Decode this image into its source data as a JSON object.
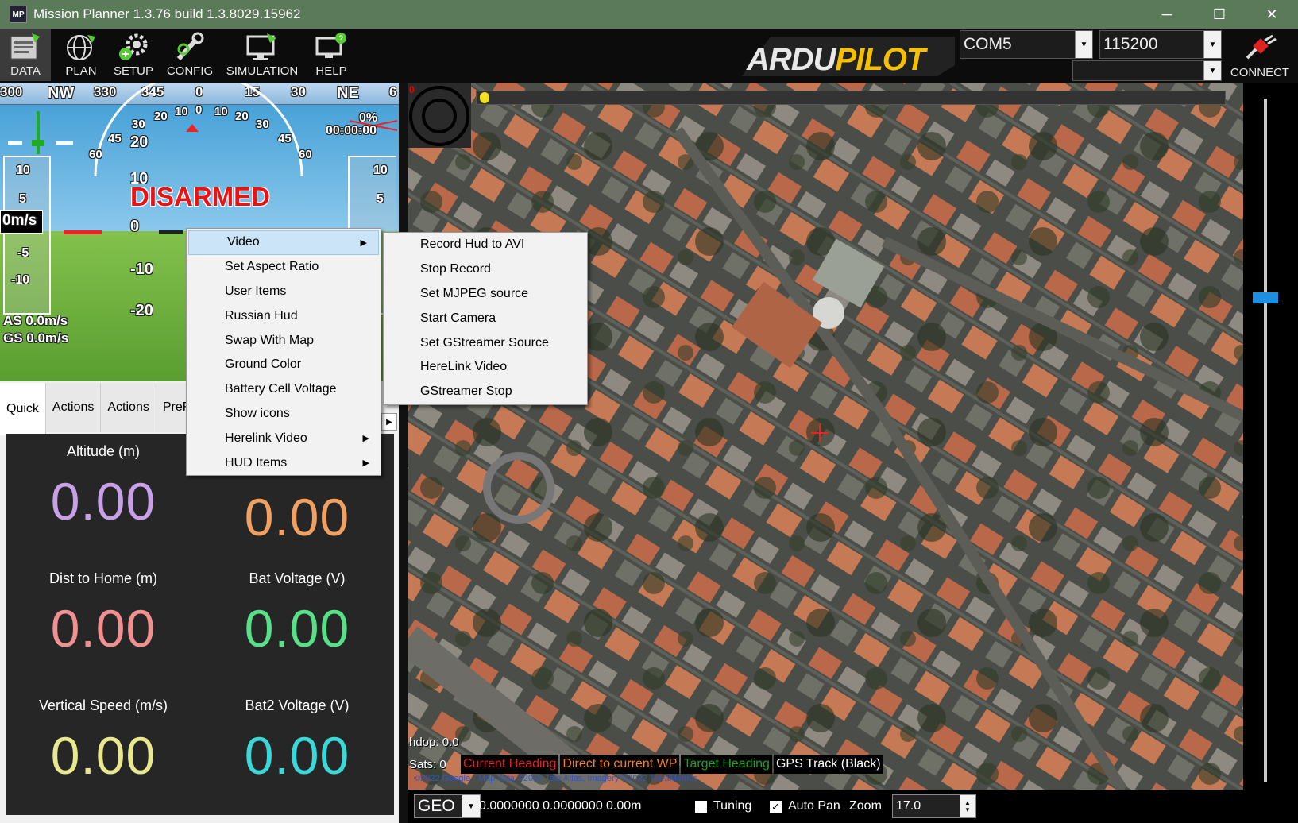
{
  "window": {
    "title": "Mission Planner 1.3.76 build 1.3.8029.15962",
    "icon_text": "MP",
    "minimize": "─",
    "maximize": "☐",
    "close": "✕"
  },
  "toolbar": {
    "buttons": [
      "DATA",
      "PLAN",
      "SETUP",
      "CONFIG",
      "SIMULATION",
      "HELP"
    ],
    "logo": "ARDUPILOT",
    "port": "COM5",
    "baud": "115200",
    "connect": "CONNECT"
  },
  "hud": {
    "compass_labels": [
      "300",
      "NW",
      "330",
      "345",
      "0",
      "15",
      "30",
      "NE",
      "6"
    ],
    "status": "DISARMED",
    "timer": "00:00:00",
    "battery_pct": "0%",
    "speed": "0m/s",
    "as": "AS 0.0m/s",
    "gs": "GS 0.0m/s",
    "pitch": [
      "20",
      "10",
      "0",
      "-10",
      "-20"
    ],
    "left_tape": [
      "10",
      "5",
      "-5",
      "-10"
    ],
    "right_tape": [
      "10",
      "5"
    ],
    "roll_marks": [
      "60",
      "45",
      "30",
      "20",
      "10",
      "0",
      "10",
      "20",
      "30",
      "45",
      "60"
    ]
  },
  "tabs": [
    "Quick",
    "Actions",
    "Actions",
    "PreF"
  ],
  "quick": [
    {
      "label": "Altitude (m)",
      "value": "0.00",
      "color": "#c9a0e8"
    },
    {
      "label": "",
      "value": "0.00",
      "color": "#f0a060"
    },
    {
      "label": "Dist to Home (m)",
      "value": "0.00",
      "color": "#f09090"
    },
    {
      "label": "Bat Voltage (V)",
      "value": "0.00",
      "color": "#58e088"
    },
    {
      "label": "Vertical Speed (m/s)",
      "value": "0.00",
      "color": "#e8e890"
    },
    {
      "label": "Bat2 Voltage (V)",
      "value": "0.00",
      "color": "#3cd8d8"
    }
  ],
  "context_menu": {
    "items": [
      "Video",
      "Set Aspect Ratio",
      "User Items",
      "Russian Hud",
      "Swap With Map",
      "Ground Color",
      "Battery Cell Voltage",
      "Show icons",
      "Herelink Video",
      "HUD Items"
    ]
  },
  "video_submenu": {
    "items": [
      "Record Hud to AVI",
      "Stop Record",
      "Set MJPEG source",
      "Start Camera",
      "Set GStreamer Source",
      "HereLink Video",
      "GStreamer Stop"
    ]
  },
  "map": {
    "hdop": "hdop: 0.0",
    "sats": "Sats: 0",
    "legend": [
      {
        "text": "Current Heading",
        "color": "#e02020"
      },
      {
        "text": "Direct to current WP",
        "color": "#f08020"
      },
      {
        "text": "Target Heading",
        "color": "#20a020"
      },
      {
        "text": "GPS Track (Black)",
        "color": "#ffffff"
      }
    ],
    "copyright": "©2022 Google - Map data ©2022 Tele Atlas, Imagery ©2022 TerraMetrics",
    "dist_marker": "0"
  },
  "statusbar": {
    "coord_mode": "GEO",
    "coords": "0.0000000 0.0000000",
    "alt": "0.00m",
    "tuning": "Tuning",
    "autopan": "Auto Pan",
    "zoom_label": "Zoom",
    "zoom_value": "17.0"
  }
}
